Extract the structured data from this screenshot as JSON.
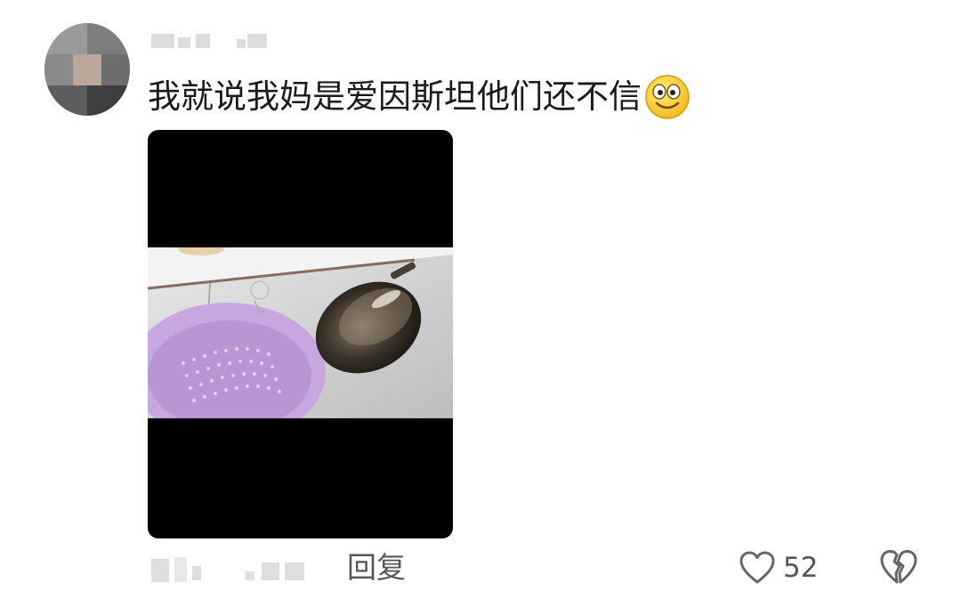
{
  "comment": {
    "text": "我就说我妈是爱因斯坦他们还不信",
    "emoji": "smiley-emoji"
  },
  "actions": {
    "reply_label": "回复",
    "like_count": "52"
  },
  "icons": {
    "like": "heart-outline-icon",
    "dislike": "broken-heart-icon"
  },
  "colors": {
    "text": "#1a1a1a",
    "muted": "#555555",
    "media_bg": "#000000"
  }
}
